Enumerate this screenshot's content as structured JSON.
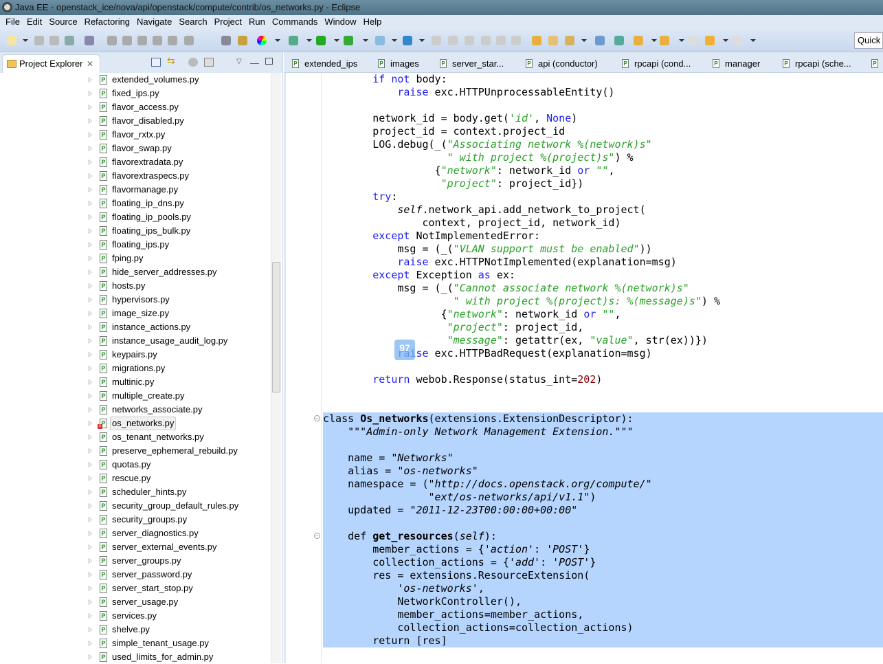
{
  "window": {
    "title": "Java EE - openstack_ice/nova/api/openstack/compute/contrib/os_networks.py - Eclipse"
  },
  "menu": [
    "File",
    "Edit",
    "Source",
    "Refactoring",
    "Navigate",
    "Search",
    "Project",
    "Run",
    "Commands",
    "Window",
    "Help"
  ],
  "toolbar": {
    "quick_access": "Quick Access"
  },
  "project_explorer": {
    "title": "Project Explorer",
    "items": [
      "extended_volumes.py",
      "fixed_ips.py",
      "flavor_access.py",
      "flavor_disabled.py",
      "flavor_rxtx.py",
      "flavor_swap.py",
      "flavorextradata.py",
      "flavorextraspecs.py",
      "flavormanage.py",
      "floating_ip_dns.py",
      "floating_ip_pools.py",
      "floating_ips_bulk.py",
      "floating_ips.py",
      "fping.py",
      "hide_server_addresses.py",
      "hosts.py",
      "hypervisors.py",
      "image_size.py",
      "instance_actions.py",
      "instance_usage_audit_log.py",
      "keypairs.py",
      "migrations.py",
      "multinic.py",
      "multiple_create.py",
      "networks_associate.py",
      "os_networks.py",
      "os_tenant_networks.py",
      "preserve_ephemeral_rebuild.py",
      "quotas.py",
      "rescue.py",
      "scheduler_hints.py",
      "security_group_default_rules.py",
      "security_groups.py",
      "server_diagnostics.py",
      "server_external_events.py",
      "server_groups.py",
      "server_password.py",
      "server_start_stop.py",
      "server_usage.py",
      "services.py",
      "shelve.py",
      "simple_tenant_usage.py",
      "used_limits_for_admin.py"
    ],
    "selected": "os_networks.py"
  },
  "editor": {
    "tabs": [
      "extended_ips",
      "images",
      "server_star...",
      "api (conductor)",
      "rpcapi (cond...",
      "manager",
      "rpcapi (sche..."
    ],
    "overlay_badge": "97",
    "lines": [
      [
        [
          "",
          "        "
        ],
        [
          "kw",
          "if not"
        ],
        [
          "",
          " body:"
        ]
      ],
      [
        [
          "",
          "            "
        ],
        [
          "kw",
          "raise"
        ],
        [
          "",
          " exc.HTTPUnprocessableEntity()"
        ]
      ],
      [],
      [
        [
          "",
          "        network_id = body.get("
        ],
        [
          "str",
          "'id'"
        ],
        [
          "",
          ", "
        ],
        [
          "kw",
          "None"
        ],
        [
          "",
          ")"
        ]
      ],
      [
        [
          "",
          "        project_id = context.project_id"
        ]
      ],
      [
        [
          "",
          "        LOG.debug(_("
        ],
        [
          "str",
          "\"Associating network %(network)s\""
        ]
      ],
      [
        [
          "",
          "                    "
        ],
        [
          "str",
          "\" with project %(project)s\""
        ],
        [
          "",
          ") %"
        ]
      ],
      [
        [
          "",
          "                  {"
        ],
        [
          "str",
          "\"network\""
        ],
        [
          "",
          ": network_id "
        ],
        [
          "kw",
          "or"
        ],
        [
          "",
          " "
        ],
        [
          "str",
          "\"\""
        ],
        [
          "",
          ","
        ]
      ],
      [
        [
          "",
          "                   "
        ],
        [
          "str",
          "\"project\""
        ],
        [
          "",
          ": project_id})"
        ]
      ],
      [
        [
          "",
          "        "
        ],
        [
          "kw",
          "try"
        ],
        [
          "",
          ":"
        ]
      ],
      [
        [
          "",
          "            "
        ],
        [
          "ital",
          "self"
        ],
        [
          "",
          ".network_api.add_network_to_project("
        ]
      ],
      [
        [
          "",
          "                context, project_id, network_id)"
        ]
      ],
      [
        [
          "",
          "        "
        ],
        [
          "kw",
          "except"
        ],
        [
          "",
          " NotImplementedError:"
        ]
      ],
      [
        [
          "",
          "            msg = (_("
        ],
        [
          "str",
          "\"VLAN support must be enabled\""
        ],
        [
          "",
          "))"
        ]
      ],
      [
        [
          "",
          "            "
        ],
        [
          "kw",
          "raise"
        ],
        [
          "",
          " exc.HTTPNotImplemented(explanation=msg)"
        ]
      ],
      [
        [
          "",
          "        "
        ],
        [
          "kw",
          "except"
        ],
        [
          "",
          " Exception "
        ],
        [
          "kw",
          "as"
        ],
        [
          "",
          " ex:"
        ]
      ],
      [
        [
          "",
          "            msg = (_("
        ],
        [
          "str",
          "\"Cannot associate network %(network)s\""
        ]
      ],
      [
        [
          "",
          "                     "
        ],
        [
          "str",
          "\" with project %(project)s: %(message)s\""
        ],
        [
          "",
          ") %"
        ]
      ],
      [
        [
          "",
          "                   {"
        ],
        [
          "str",
          "\"network\""
        ],
        [
          "",
          ": network_id "
        ],
        [
          "kw",
          "or"
        ],
        [
          "",
          " "
        ],
        [
          "str",
          "\"\""
        ],
        [
          "",
          ","
        ]
      ],
      [
        [
          "",
          "                    "
        ],
        [
          "str",
          "\"project\""
        ],
        [
          "",
          ": project_id,"
        ]
      ],
      [
        [
          "",
          "                    "
        ],
        [
          "str",
          "\"message\""
        ],
        [
          "",
          ": getattr(ex, "
        ],
        [
          "str",
          "\"value\""
        ],
        [
          "",
          ", str(ex))})"
        ]
      ],
      [
        [
          "",
          "            "
        ],
        [
          "kw",
          "raise"
        ],
        [
          "",
          " exc.HTTPBadRequest(explanation=msg)"
        ]
      ],
      [],
      [
        [
          "",
          "        "
        ],
        [
          "kw",
          "return"
        ],
        [
          "",
          " webob.Response(status_int="
        ],
        [
          "num",
          "202"
        ],
        [
          "",
          ")"
        ]
      ],
      [],
      [],
      [
        [
          "",
          "class "
        ],
        [
          "bold",
          "Os_networks"
        ],
        [
          "",
          "(extensions.ExtensionDescriptor):"
        ]
      ],
      [
        [
          "",
          "    "
        ],
        [
          "doc",
          "\"\"\"Admin-only Network Management Extension.\"\"\""
        ]
      ],
      [],
      [
        [
          "",
          "    name = "
        ],
        [
          "doc",
          "\"Networks\""
        ]
      ],
      [
        [
          "",
          "    alias = "
        ],
        [
          "doc",
          "\"os-networks\""
        ]
      ],
      [
        [
          "",
          "    namespace = ("
        ],
        [
          "doc",
          "\"http://docs.openstack.org/compute/\""
        ]
      ],
      [
        [
          "",
          "                 "
        ],
        [
          "doc",
          "\"ext/os-networks/api/v1.1\""
        ],
        [
          "",
          ")"
        ]
      ],
      [
        [
          "",
          "    updated = "
        ],
        [
          "doc",
          "\"2011-12-23T00:00:00+00:00\""
        ]
      ],
      [],
      [
        [
          "",
          "    def "
        ],
        [
          "bold",
          "get_resources"
        ],
        [
          "",
          "("
        ],
        [
          "ital",
          "self"
        ],
        [
          "",
          "):"
        ]
      ],
      [
        [
          "",
          "        member_actions = {"
        ],
        [
          "doc",
          "'action'"
        ],
        [
          "",
          ": "
        ],
        [
          "doc",
          "'POST'"
        ],
        [
          "",
          "}"
        ]
      ],
      [
        [
          "",
          "        collection_actions = {"
        ],
        [
          "doc",
          "'add'"
        ],
        [
          "",
          ": "
        ],
        [
          "doc",
          "'POST'"
        ],
        [
          "",
          "}"
        ]
      ],
      [
        [
          "",
          "        res = extensions.ResourceExtension("
        ]
      ],
      [
        [
          "",
          "            "
        ],
        [
          "doc",
          "'os-networks'"
        ],
        [
          "",
          ","
        ]
      ],
      [
        [
          "",
          "            NetworkController(),"
        ]
      ],
      [
        [
          "",
          "            member_actions=member_actions,"
        ]
      ],
      [
        [
          "",
          "            collection_actions=collection_actions)"
        ]
      ],
      [
        [
          "",
          "        return [res]"
        ]
      ]
    ]
  }
}
